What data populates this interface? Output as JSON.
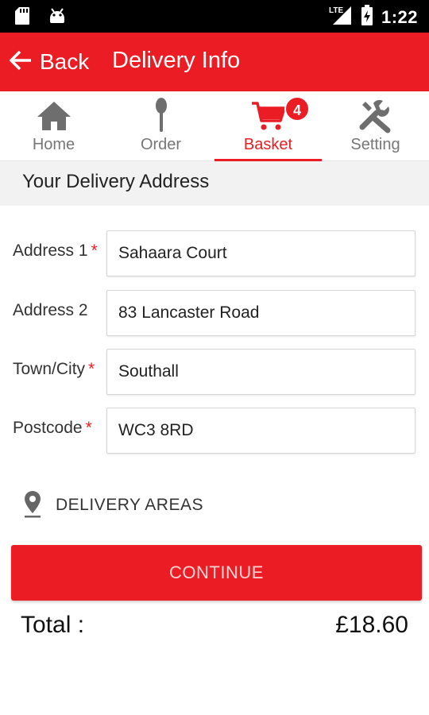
{
  "status_bar": {
    "time": "1:22",
    "network": "LTE",
    "icons": [
      "sd-card-icon",
      "android-icon",
      "signal-icon",
      "battery-icon"
    ]
  },
  "app_bar": {
    "back_label": "Back",
    "title": "Delivery Info",
    "color": "#ec1c24"
  },
  "tabs": [
    {
      "label": "Home",
      "icon": "home-icon",
      "active": false
    },
    {
      "label": "Order",
      "icon": "spoon-icon",
      "active": false
    },
    {
      "label": "Basket",
      "icon": "cart-icon",
      "active": true,
      "badge": "4"
    },
    {
      "label": "Setting",
      "icon": "tools-icon",
      "active": false
    }
  ],
  "section": {
    "title": "Your Delivery Address"
  },
  "form": {
    "fields": [
      {
        "label": "Address 1",
        "required": "*",
        "value": "Sahaara Court"
      },
      {
        "label": "Address 2",
        "required": "",
        "value": "83 Lancaster Road"
      },
      {
        "label": "Town/City",
        "required": "*",
        "value": "Southall"
      },
      {
        "label": "Postcode",
        "required": "*",
        "value": "WC3 8RD"
      }
    ]
  },
  "delivery_areas": {
    "label": "DELIVERY AREAS",
    "icon": "location-pin-icon"
  },
  "continue_button": {
    "label": "CONTINUE"
  },
  "total": {
    "label": "Total :",
    "value": "£18.60"
  }
}
